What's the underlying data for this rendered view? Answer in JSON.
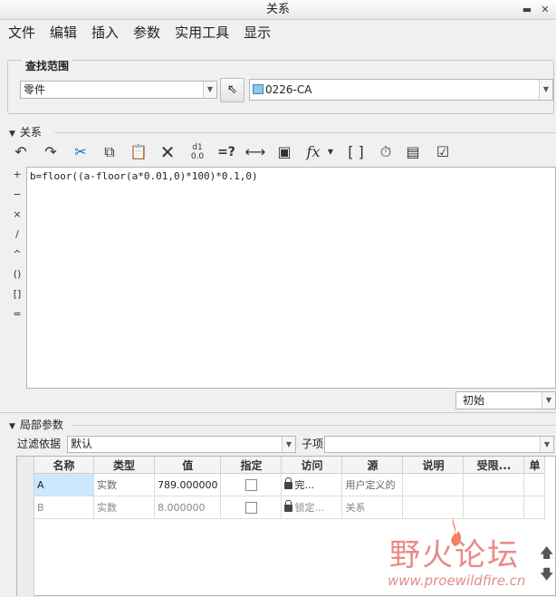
{
  "window": {
    "title": "关系"
  },
  "menu": [
    "文件",
    "编辑",
    "插入",
    "参数",
    "实用工具",
    "显示"
  ],
  "lookin": {
    "group_label": "查找范围",
    "scope_value": "零件",
    "model_value": "0226-CA"
  },
  "relations": {
    "header": "关系",
    "toolbar_icons": [
      "undo-icon",
      "redo-icon",
      "cut-icon",
      "copy-icon",
      "paste-icon",
      "delete-icon",
      "sort-icon",
      "evaluate-icon",
      "dimension-icon",
      "properties-icon",
      "function-icon",
      "brackets-icon",
      "verify-icon",
      "display-icon",
      "sort-relations-icon"
    ],
    "operators": [
      "+",
      "−",
      "×",
      "/",
      "^",
      "()",
      "[]",
      "="
    ],
    "text": "b=floor((a-floor(a*0.01,0)*100)*0.1,0)",
    "init_select": "初始"
  },
  "local_params": {
    "header": "局部参数",
    "filter_label": "过滤依据",
    "filter_value": "默认",
    "subitem_label": "子项",
    "subitem_value": "",
    "columns": [
      "名称",
      "类型",
      "值",
      "指定",
      "访问",
      "源",
      "说明",
      "受限...",
      "单"
    ],
    "rows": [
      {
        "name": "A",
        "type": "实数",
        "value": "789.000000",
        "designate": false,
        "access": "完...",
        "source": "用户定义的",
        "desc": "",
        "restricted": "",
        "unit": ""
      },
      {
        "name": "B",
        "type": "实数",
        "value": "8.000000",
        "designate": false,
        "access": "锁定...",
        "source": "关系",
        "desc": "",
        "restricted": "",
        "unit": ""
      }
    ]
  },
  "watermark": {
    "title": "野火论坛",
    "url": "www.proewildfire.cn"
  },
  "colors": {
    "accent": "#cce8ff",
    "watermark": "#e88a88"
  }
}
